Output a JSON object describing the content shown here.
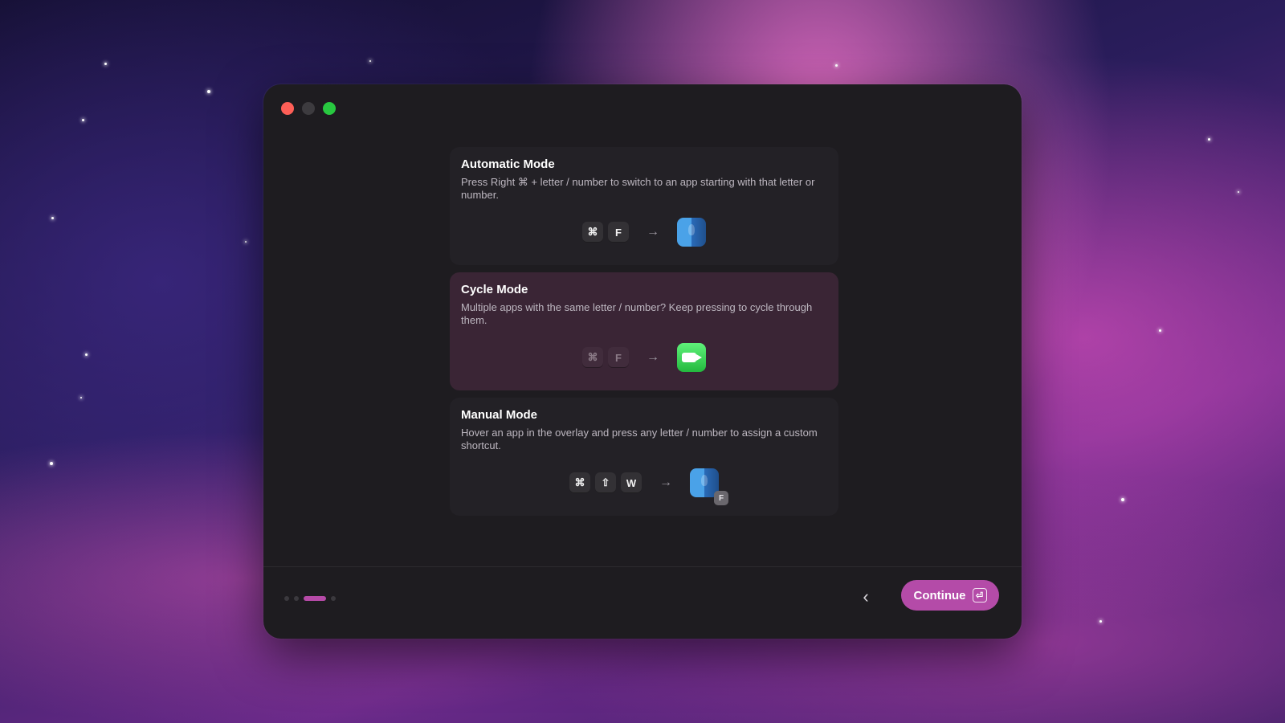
{
  "window": {
    "controls": [
      "close",
      "minimize",
      "maximize"
    ]
  },
  "modes": [
    {
      "title": "Automatic Mode",
      "description": "Press Right ⌘ + letter / number to switch to an app starting with that letter or number.",
      "keys": [
        "⌘",
        "F"
      ],
      "app_icon": "finder-icon",
      "selected": false
    },
    {
      "title": "Cycle Mode",
      "description": "Multiple apps with the same letter / number? Keep pressing to cycle through them.",
      "keys": [
        "⌘",
        "F"
      ],
      "app_icon": "facetime-icon",
      "selected": true
    },
    {
      "title": "Manual Mode",
      "description": "Hover an app in the overlay and press any letter / number to assign a custom shortcut.",
      "keys": [
        "⌘",
        "⇧",
        "W"
      ],
      "app_icon": "finder-icon",
      "badge": "F",
      "selected": false
    }
  ],
  "arrow_glyph": "→",
  "footer": {
    "pager": {
      "total": 4,
      "current": 3
    },
    "back_glyph": "‹",
    "continue_label": "Continue",
    "continue_key_glyph": "⏎"
  },
  "colors": {
    "accent": "#b44ba8",
    "selected_card": "#3a2535",
    "window_bg": "#1e1c20"
  }
}
